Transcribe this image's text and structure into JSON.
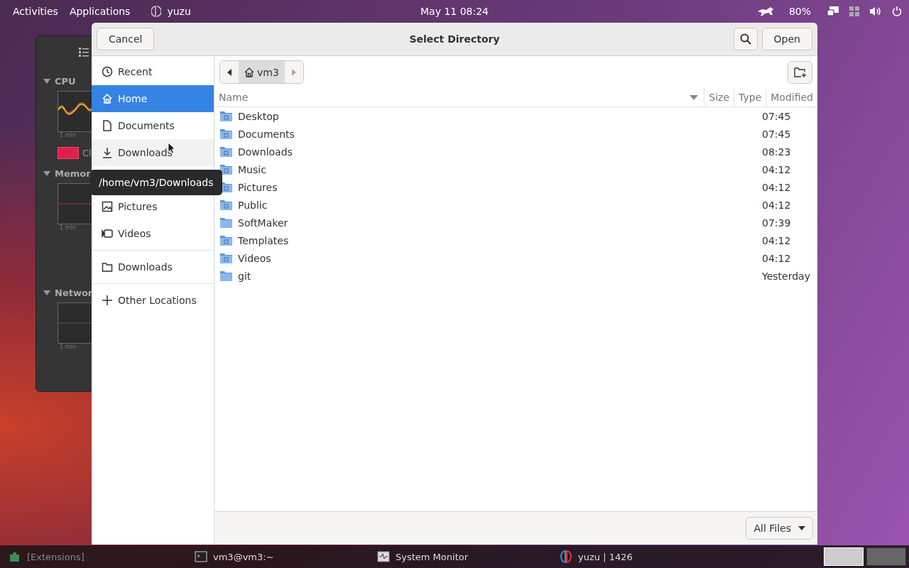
{
  "top_bar": {
    "activities": "Activities",
    "applications": "Applications",
    "app_name": "yuzu",
    "clock": "May 11  08:24",
    "battery": "80%"
  },
  "background_window": {
    "sections": [
      {
        "title": "CPU",
        "time_label": "1 min",
        "legend": "Cl"
      },
      {
        "title": "Memor",
        "time_label": "1 min"
      },
      {
        "title": "Networ",
        "time_label": "1 min"
      }
    ]
  },
  "dialog": {
    "title": "Select Directory",
    "cancel": "Cancel",
    "open": "Open",
    "sidebar": [
      {
        "label": "Recent",
        "kind": "recent",
        "selected": false,
        "hovered": false
      },
      {
        "label": "Home",
        "kind": "home",
        "selected": true,
        "hovered": false
      },
      {
        "label": "Documents",
        "kind": "document",
        "selected": false,
        "hovered": false
      },
      {
        "label": "Downloads",
        "kind": "download",
        "selected": false,
        "hovered": true
      },
      {
        "label": "Pictures",
        "kind": "picture",
        "selected": false,
        "hovered": false
      },
      {
        "label": "Videos",
        "kind": "video",
        "selected": false,
        "hovered": false
      },
      {
        "label": "Downloads",
        "kind": "folder",
        "selected": false,
        "hovered": false
      },
      {
        "label": "Other Locations",
        "kind": "plus",
        "selected": false,
        "hovered": false
      }
    ],
    "tooltip": "/home/vm3/Downloads",
    "path": "vm3",
    "columns": [
      "Name",
      "Size",
      "Type",
      "Modified"
    ],
    "rows": [
      {
        "name": "Desktop",
        "modified": "07:45"
      },
      {
        "name": "Documents",
        "modified": "07:45"
      },
      {
        "name": "Downloads",
        "modified": "08:23"
      },
      {
        "name": "Music",
        "modified": "04:12"
      },
      {
        "name": "Pictures",
        "modified": "04:12"
      },
      {
        "name": "Public",
        "modified": "04:12"
      },
      {
        "name": "SoftMaker",
        "modified": "07:39"
      },
      {
        "name": "Templates",
        "modified": "04:12"
      },
      {
        "name": "Videos",
        "modified": "04:12"
      },
      {
        "name": "git",
        "modified": "Yesterday"
      }
    ],
    "filter": "All Files"
  },
  "taskbar": {
    "items": [
      "[Extensions]",
      "vm3@vm3:~",
      "System Monitor",
      "yuzu | 1426"
    ],
    "workspaces": [
      {
        "selected": true
      },
      {
        "selected": false
      }
    ]
  }
}
